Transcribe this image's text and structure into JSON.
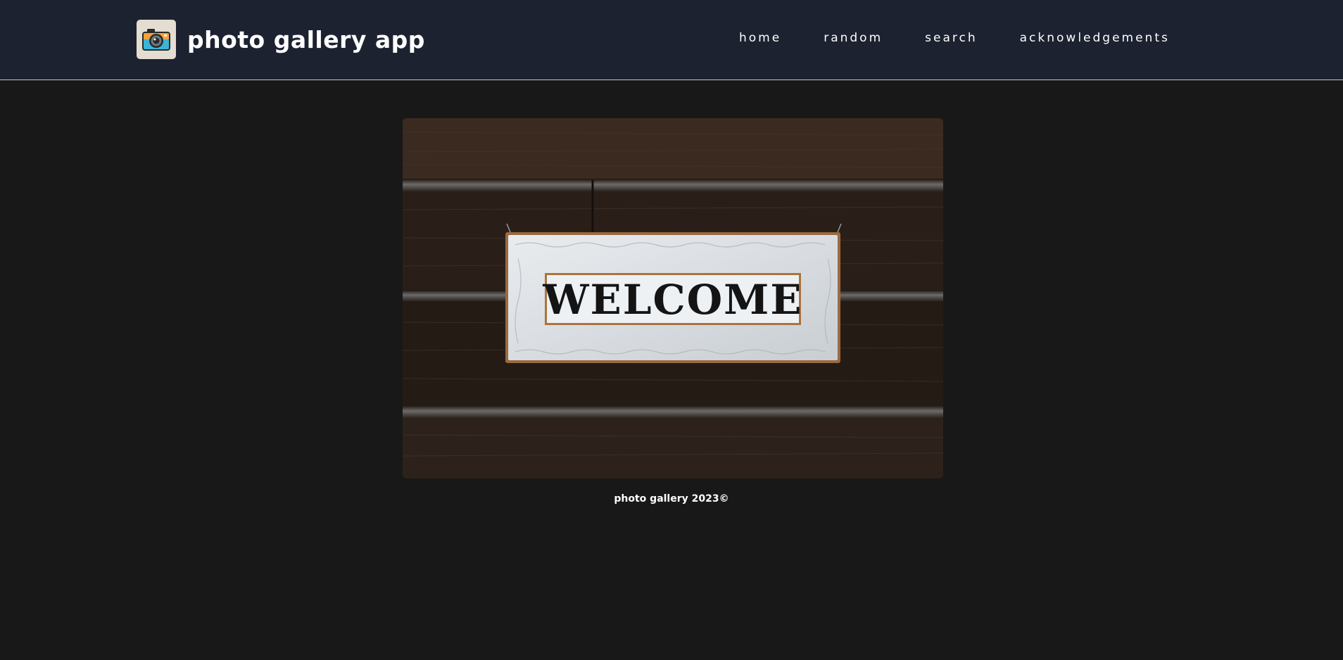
{
  "header": {
    "title": "photo gallery app",
    "logo_icon": "camera-icon",
    "background": "#1d2231"
  },
  "nav": {
    "items": [
      {
        "label": "home"
      },
      {
        "label": "random"
      },
      {
        "label": "search"
      },
      {
        "label": "acknowledgements"
      }
    ]
  },
  "photo": {
    "sign_text": "WELCOME"
  },
  "footer": {
    "text": "photo gallery 2023©"
  },
  "colors": {
    "page_background": "#181818",
    "text": "#ffffff"
  }
}
